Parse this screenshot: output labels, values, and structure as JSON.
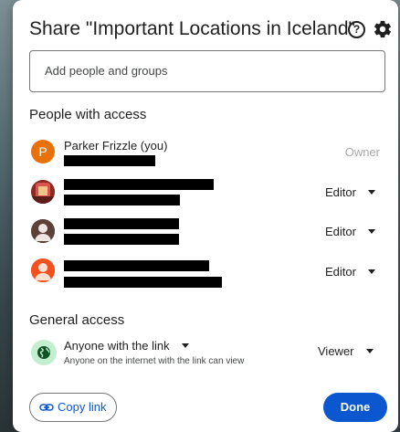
{
  "dialog": {
    "title": "Share \"Important Locations in Iceland\"",
    "help_icon": "help-circle-icon",
    "settings_icon": "gear-icon"
  },
  "add_people": {
    "placeholder": "Add people and groups"
  },
  "people_section": {
    "title": "People with access",
    "people": [
      {
        "name": "Parker Frizzle (you)",
        "avatar_letter": "P",
        "avatar_color": "#e8710a",
        "role": "Owner"
      },
      {
        "role": "Editor"
      },
      {
        "role": "Editor"
      },
      {
        "role": "Editor"
      }
    ]
  },
  "general_access": {
    "title": "General access",
    "access_label": "Anyone with the link",
    "access_description": "Anyone on the internet with the link can view",
    "role": "Viewer"
  },
  "footer": {
    "copy_link_label": "Copy link",
    "done_label": "Done"
  },
  "colors": {
    "accent": "#0b57d0",
    "globe_bg": "#c4eed0",
    "globe_fg": "#0f5223"
  }
}
